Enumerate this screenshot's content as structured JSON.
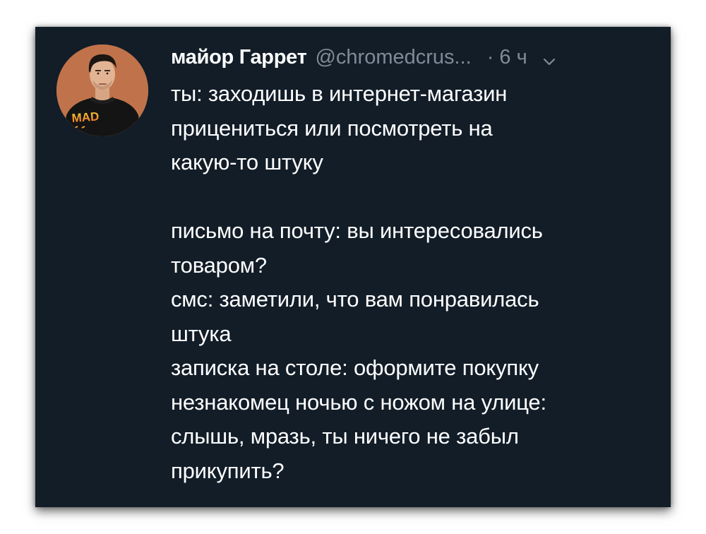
{
  "tweet": {
    "display_name": "майор Гаррет",
    "handle": "@chromedcrus...",
    "separator": "·",
    "time": "6 ч",
    "avatar": {
      "shirt_text": "MAD",
      "shirt_text_colors": [
        "#f6d23b",
        "#ee6a1f"
      ]
    },
    "colors": {
      "background": "#121d28",
      "text": "#ffffff",
      "secondary": "#7f8b97"
    },
    "lines": [
      "ты: заходишь в интернет-магазин",
      "прицениться или посмотреть на",
      "какую-то штуку",
      "",
      "письмо на почту: вы интересовались",
      "товаром?",
      "смс: заметили, что вам понравилась",
      "штука",
      "записка на столе: оформите покупку",
      "незнакомец ночью с ножом на улице:",
      "слышь, мразь, ты ничего не забыл",
      "прикупить?"
    ]
  }
}
